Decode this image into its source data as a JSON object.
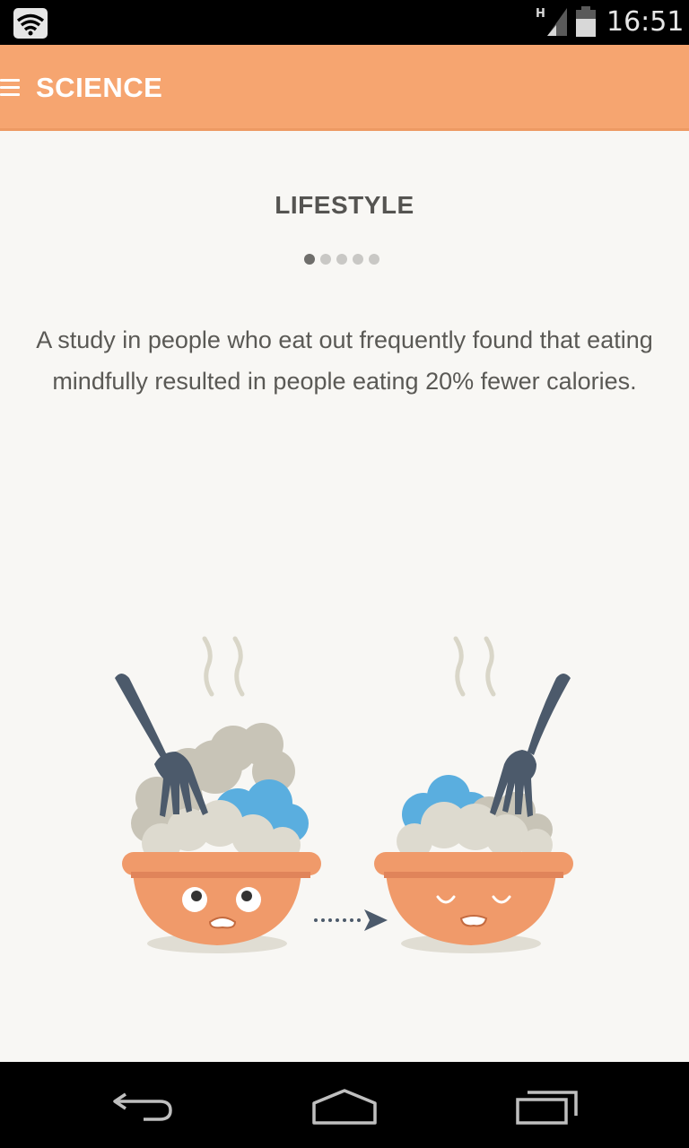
{
  "status_bar": {
    "time": "16:51",
    "network_type": "H",
    "icons": [
      "wifi-icon",
      "signal-icon",
      "battery-icon"
    ]
  },
  "app_bar": {
    "title": "SCIENCE",
    "menu_icon": "hamburger-menu-icon"
  },
  "content": {
    "section_title": "LIFESTYLE",
    "pager": {
      "total": 5,
      "current": 1
    },
    "fact_text": "A study in people who eat out frequently found that eating mindfully resulted in people eating 20% fewer calories."
  },
  "colors": {
    "accent": "#f6a570",
    "bowl": "#f09a6a",
    "blue_food": "#5aaedf",
    "fork": "#4c5a6b",
    "background": "#f8f7f4"
  },
  "nav_bar": {
    "icons": [
      "back-icon",
      "home-icon",
      "recent-apps-icon"
    ]
  }
}
